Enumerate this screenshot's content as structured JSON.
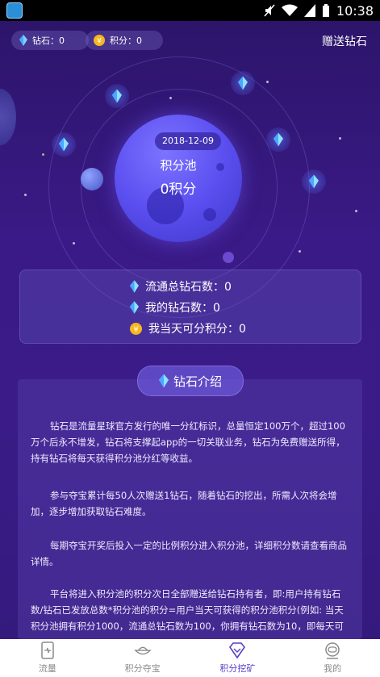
{
  "status_bar": {
    "time": "10:38"
  },
  "header": {
    "diamond_pill": "钻石：0",
    "points_pill": "积分：0",
    "gift_label": "赠送钻石"
  },
  "pool": {
    "date": "2018-12-09",
    "title": "积分池",
    "value": "0积分"
  },
  "stats": [
    {
      "label": "流通总钻石数：0",
      "icon": "diamond-icon"
    },
    {
      "label": "我的钻石数：0",
      "icon": "diamond-icon"
    },
    {
      "label": "我当天可分积分：0",
      "icon": "coin-icon"
    }
  ],
  "intro": {
    "tab_label": "钻石介绍",
    "paragraphs": [
      "钻石是流量星球官方发行的唯一分红标识，总量恒定100万个，超过100万个后永不增发，钻石将支撑起app的一切关联业务，钻石为免费赠送所得，持有钻石将每天获得积分池分红等收益。",
      "参与夺宝累计每50人次赠送1钻石，随着钻石的挖出，所需人次将会增加，逐步增加获取钻石难度。",
      "每期夺宝开奖后投入一定的比例积分进入积分池，详细积分数请查看商品详情。",
      "平台将进入积分池的积分次日全部赠送给钻石持有者，即:用户持有钻石数/钻石已发放总数*积分池的积分=用户当天可获得的积分池积分(例如: 当天积分池拥有积分1000，流通总钻石数为100，你拥有钻石数为10，即每天可"
    ]
  },
  "nav": {
    "items": [
      {
        "label": "流量",
        "icon": "phone-icon",
        "active": false
      },
      {
        "label": "积分夺宝",
        "icon": "treasure-icon",
        "active": false
      },
      {
        "label": "积分挖矿",
        "icon": "diamond-outline-icon",
        "active": true
      },
      {
        "label": "我的",
        "icon": "astronaut-icon",
        "active": false
      }
    ]
  },
  "colors": {
    "accent": "#5a3fc6",
    "background": "#3a1a86",
    "coin": "#f5b820"
  }
}
